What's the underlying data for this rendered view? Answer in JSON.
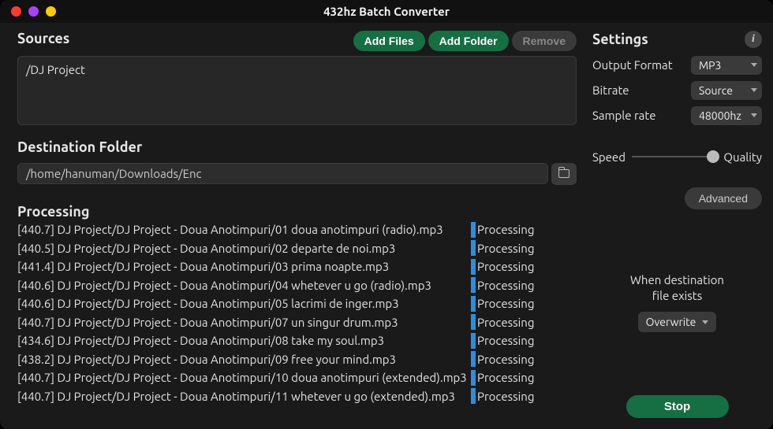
{
  "window": {
    "title": "432hz Batch Converter"
  },
  "sources": {
    "heading": "Sources",
    "add_files": "Add Files",
    "add_folder": "Add Folder",
    "remove": "Remove",
    "items": [
      "/DJ Project"
    ]
  },
  "destination": {
    "heading": "Destination Folder",
    "path": "/home/hanuman/Downloads/Enc"
  },
  "processing": {
    "heading": "Processing",
    "items": [
      {
        "hz": "[440.7]",
        "path": "DJ Project/DJ Project - Doua Anotimpuri/01 doua anotimpuri (radio).mp3",
        "status": "Processing"
      },
      {
        "hz": "[440.5]",
        "path": "DJ Project/DJ Project - Doua Anotimpuri/02 departe de noi.mp3",
        "status": "Processing"
      },
      {
        "hz": "[441.4]",
        "path": "DJ Project/DJ Project - Doua Anotimpuri/03 prima noapte.mp3",
        "status": "Processing"
      },
      {
        "hz": "[440.6]",
        "path": "DJ Project/DJ Project - Doua Anotimpuri/04 whetever u go (radio).mp3",
        "status": "Processing"
      },
      {
        "hz": "[440.6]",
        "path": "DJ Project/DJ Project - Doua Anotimpuri/05 lacrimi de inger.mp3",
        "status": "Processing"
      },
      {
        "hz": "[440.7]",
        "path": "DJ Project/DJ Project - Doua Anotimpuri/07 un singur drum.mp3",
        "status": "Processing"
      },
      {
        "hz": "[434.6]",
        "path": "DJ Project/DJ Project - Doua Anotimpuri/08 take my soul.mp3",
        "status": "Processing"
      },
      {
        "hz": "[438.2]",
        "path": "DJ Project/DJ Project - Doua Anotimpuri/09 free your mind.mp3",
        "status": "Processing"
      },
      {
        "hz": "[440.7]",
        "path": "DJ Project/DJ Project - Doua Anotimpuri/10 doua anotimpuri (extended).mp3",
        "status": "Processing"
      },
      {
        "hz": "[440.7]",
        "path": "DJ Project/DJ Project - Doua Anotimpuri/11 whetever u go (extended).mp3",
        "status": "Processing"
      }
    ]
  },
  "settings": {
    "heading": "Settings",
    "output_format_label": "Output Format",
    "output_format": "MP3",
    "bitrate_label": "Bitrate",
    "bitrate": "Source",
    "sample_rate_label": "Sample rate",
    "sample_rate": "48000hz",
    "speed_label": "Speed",
    "quality_label": "Quality",
    "advanced": "Advanced",
    "dest_exists_label": "When destination\nfile exists",
    "dest_exists_value": "Overwrite",
    "stop": "Stop"
  }
}
